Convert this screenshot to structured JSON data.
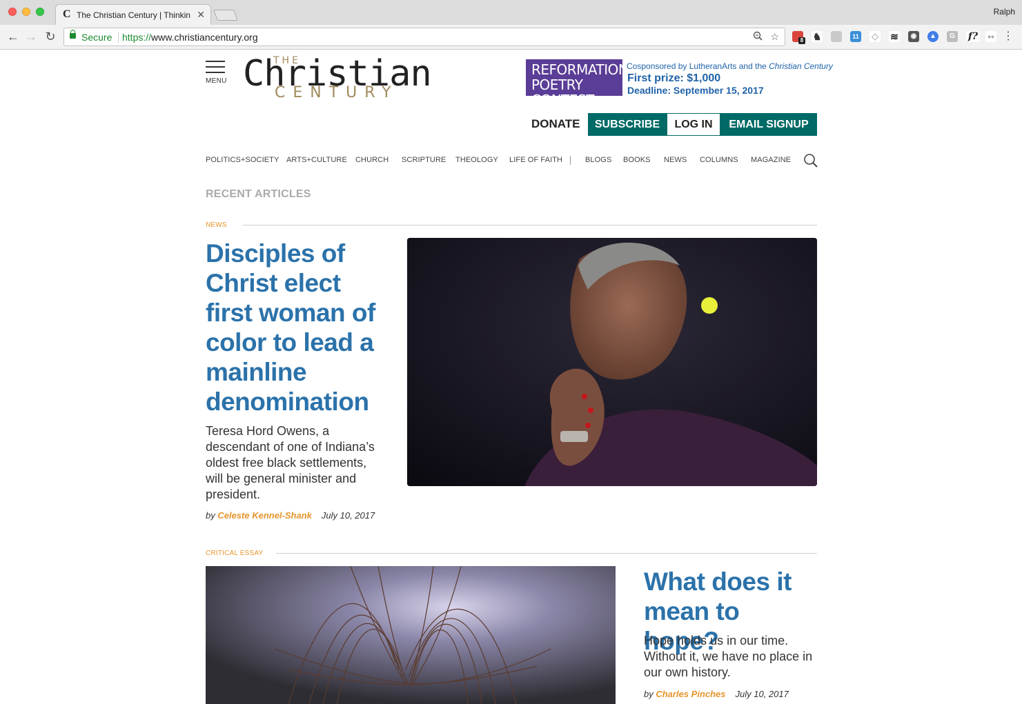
{
  "browser": {
    "tab_title": "The Christian Century | Thinkin",
    "tab_favicon": "C",
    "profile_name": "Ralph",
    "secure_label": "Secure",
    "url_scheme": "https://",
    "url_host": "www.christiancentury.org",
    "extension_badge": "8",
    "extension_calendar": "11",
    "extension_fq": "f?"
  },
  "site": {
    "menu_label": "MENU",
    "logo": {
      "the": "THE",
      "name": "Christian",
      "century": "CENTURY"
    },
    "ad": {
      "title_line1": "REFORMATION",
      "title_line2": "POETRY CONTEST",
      "cosponsor_prefix": "Cosponsored by LutheranArts and the ",
      "cosponsor_pub": "Christian Century",
      "prize": "First prize: $1,000",
      "deadline": "Deadline: September 15, 2017"
    },
    "actions": {
      "donate": "DONATE",
      "subscribe": "SUBSCRIBE",
      "login": "LOG IN",
      "email_signup": "EMAIL SIGNUP"
    },
    "nav": [
      "POLITICS+SOCIETY",
      "ARTS+CULTURE",
      "CHURCH",
      "SCRIPTURE",
      "THEOLOGY",
      "LIFE OF FAITH",
      "BLOGS",
      "BOOKS",
      "NEWS",
      "COLUMNS",
      "MAGAZINE"
    ],
    "section_title": "RECENT ARTICLES"
  },
  "articles": [
    {
      "kicker": "NEWS",
      "headline": "Disciples of Christ elect first woman of color to lead a mainline denomination",
      "dek": "Teresa Hord Owens, a descendant of one of Indiana’s oldest free black settlements, will be general minister and president.",
      "by": "by ",
      "author": "Celeste Kennel-Shank",
      "date": "July 10, 2017"
    },
    {
      "kicker": "CRITICAL ESSAY",
      "headline": "What does it mean to hope?",
      "dek": "Hope holds us in our time. Without it, we have no place in our own history.",
      "by": "by ",
      "author": "Charles Pinches",
      "date": "July 10, 2017"
    }
  ],
  "colors": {
    "brand_teal": "#006a66",
    "headline_blue": "#2b72aa",
    "kicker_orange": "#e5952b",
    "ad_purple": "#5a3d96",
    "logo_gold": "#a08a5c"
  }
}
